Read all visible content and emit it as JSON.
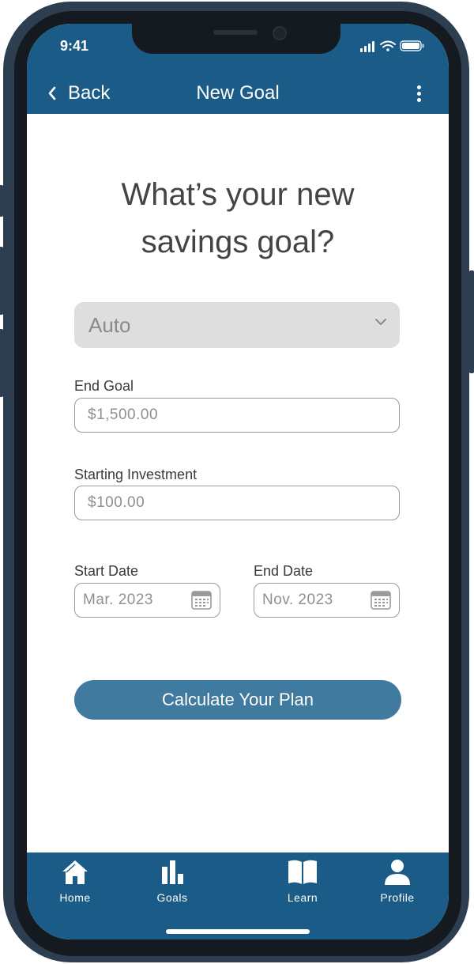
{
  "status_bar": {
    "time": "9:41"
  },
  "nav": {
    "back_label": "Back",
    "title": "New Goal",
    "more_icon": "more-vertical-icon"
  },
  "heading": {
    "line1": "What’s your new",
    "line2": "savings goal?"
  },
  "category_select": {
    "value": "Auto",
    "icon": "chevron-down-icon"
  },
  "end_goal": {
    "label": "End Goal",
    "placeholder": "$1,500.00"
  },
  "starting_investment": {
    "label": "Starting Investment",
    "placeholder": "$100.00"
  },
  "start_date": {
    "label": "Start Date",
    "placeholder": "Mar. 2023",
    "icon": "calendar-icon"
  },
  "end_date": {
    "label": "End Date",
    "placeholder": "Nov. 2023",
    "icon": "calendar-icon"
  },
  "cta": {
    "label": "Calculate Your Plan"
  },
  "tabs": [
    {
      "label": "Home",
      "icon": "home-icon"
    },
    {
      "label": "Goals",
      "icon": "bar-chart-icon"
    },
    {
      "label": "Learn",
      "icon": "book-icon"
    },
    {
      "label": "Profile",
      "icon": "person-icon"
    }
  ],
  "colors": {
    "brand": "#1a5c87",
    "button": "#407b9f",
    "frame": "#2c3e50"
  }
}
